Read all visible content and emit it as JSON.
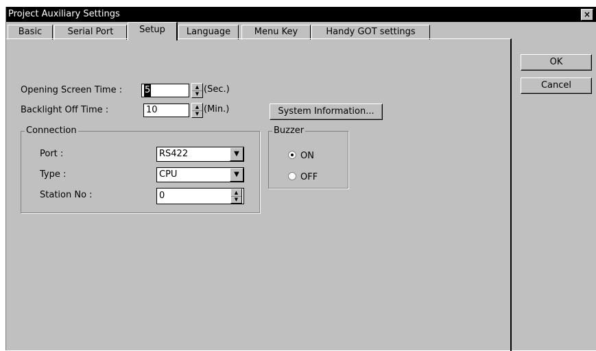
{
  "window": {
    "title": "Project Auxiliary Settings",
    "close_glyph": "×"
  },
  "tabs": [
    {
      "label": "Basic",
      "active": false
    },
    {
      "label": "Serial Port",
      "active": false
    },
    {
      "label": "Setup",
      "active": true
    },
    {
      "label": "Language",
      "active": false
    },
    {
      "label": "Menu Key",
      "active": false
    },
    {
      "label": "Handy GOT settings",
      "active": false
    }
  ],
  "setup": {
    "opening_screen_time": {
      "label": "Opening Screen Time :",
      "value": "5",
      "unit": "(Sec.)"
    },
    "backlight_off_time": {
      "label": "Backlight Off Time :",
      "value": "10",
      "unit": "(Min.)"
    },
    "system_info_button": "System Information...",
    "connection": {
      "title": "Connection",
      "port": {
        "label": "Port :",
        "value": "RS422"
      },
      "type": {
        "label": "Type :",
        "value": "CPU"
      },
      "station": {
        "label": "Station No :",
        "value": "0"
      }
    },
    "buzzer": {
      "title": "Buzzer",
      "options": [
        {
          "label": "ON",
          "selected": true
        },
        {
          "label": "OFF",
          "selected": false
        }
      ]
    }
  },
  "buttons": {
    "ok": "OK",
    "cancel": "Cancel"
  },
  "icons": {
    "spin_up": "spin-up-arrow",
    "spin_down": "spin-down-arrow",
    "dropdown": "chevron-down-icon"
  }
}
